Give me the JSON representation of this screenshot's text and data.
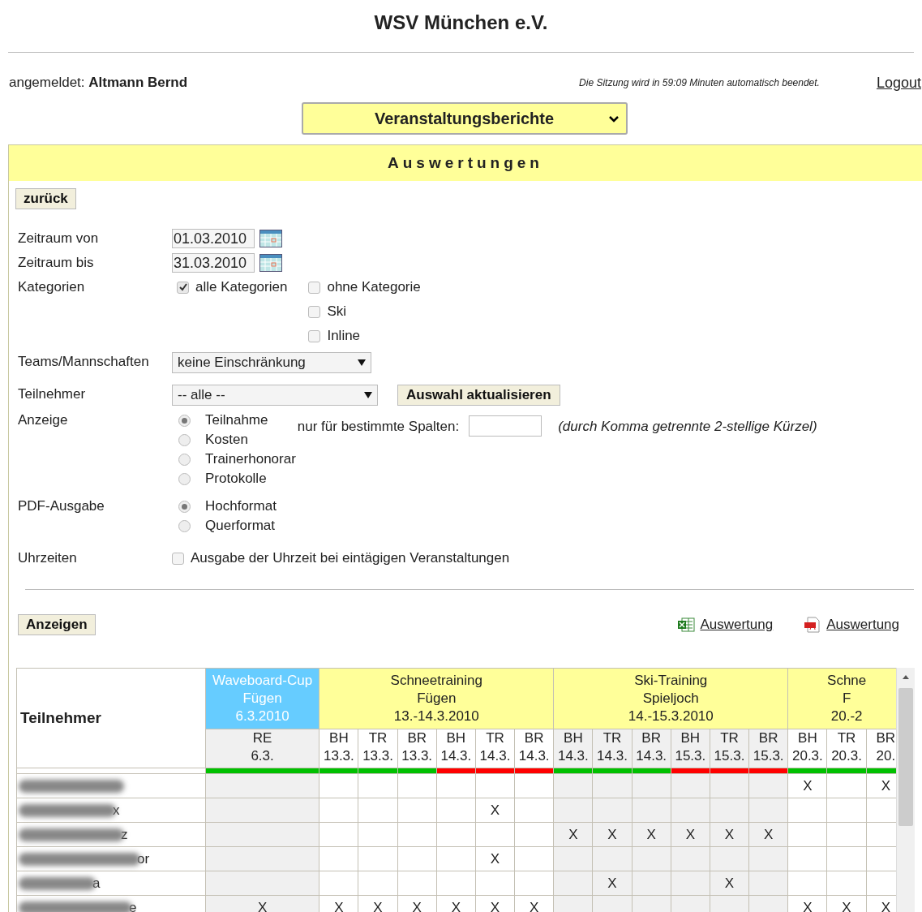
{
  "header": {
    "title": "WSV München e.V."
  },
  "user_bar": {
    "label": "angemeldet:",
    "user": "Altmann Bernd",
    "session_note": "Die Sitzung wird in 59:09 Minuten automatisch beendet.",
    "logout": "Logout"
  },
  "report_select": {
    "value": "Veranstaltungsberichte"
  },
  "panel": {
    "title": "Auswertungen",
    "back_button": "zurück",
    "form": {
      "period_from": {
        "label": "Zeitraum von",
        "value": "01.03.2010"
      },
      "period_to": {
        "label": "Zeitraum bis",
        "value": "31.03.2010"
      },
      "categories": {
        "label": "Kategorien",
        "options": [
          {
            "label": "alle Kategorien",
            "checked": true
          },
          {
            "label": "ohne Kategorie",
            "checked": false
          },
          {
            "label": "Ski",
            "checked": false
          },
          {
            "label": "Inline",
            "checked": false
          }
        ]
      },
      "teams": {
        "label": "Teams/Mannschaften",
        "value": "keine Einschränkung"
      },
      "participants": {
        "label": "Teilnehmer",
        "value": "-- alle --",
        "update_button": "Auswahl aktualisieren"
      },
      "display": {
        "label": "Anzeige",
        "options": [
          {
            "label": "Teilnahme",
            "selected": true
          },
          {
            "label": "Kosten",
            "selected": false
          },
          {
            "label": "Trainerhonorar",
            "selected": false
          },
          {
            "label": "Protokolle",
            "selected": false
          }
        ],
        "columns_label": "nur für bestimmte Spalten:",
        "columns_hint": "(durch Komma getrennte 2-stellige Kürzel)"
      },
      "pdf": {
        "label": "PDF-Ausgabe",
        "options": [
          {
            "label": "Hochformat",
            "selected": true
          },
          {
            "label": "Querformat",
            "selected": false
          }
        ]
      },
      "times": {
        "label": "Uhrzeiten",
        "option": {
          "label": "Ausgabe der Uhrzeit bei eintägigen Veranstaltungen",
          "checked": false
        }
      }
    },
    "show_button": "Anzeigen",
    "exports": [
      {
        "kind": "excel",
        "label": "Auswertung"
      },
      {
        "kind": "pdf",
        "label": "Auswertung"
      }
    ],
    "table": {
      "name_header": "Teilnehmer",
      "events": [
        {
          "lines": [
            "Waveboard-Cup",
            "Fügen",
            "6.3.2010"
          ],
          "kind": "highlight",
          "shaded": true,
          "columns": [
            {
              "code": "RE",
              "date": "6.3.",
              "color": "#00c000"
            }
          ]
        },
        {
          "lines": [
            "Schneetraining",
            "Fügen",
            "13.-14.3.2010"
          ],
          "kind": "normal",
          "shaded": false,
          "columns": [
            {
              "code": "BH",
              "date": "13.3.",
              "color": "#00c000"
            },
            {
              "code": "TR",
              "date": "13.3.",
              "color": "#00c000"
            },
            {
              "code": "BR",
              "date": "13.3.",
              "color": "#00c000"
            },
            {
              "code": "BH",
              "date": "14.3.",
              "color": "#ff0000"
            },
            {
              "code": "TR",
              "date": "14.3.",
              "color": "#ff0000"
            },
            {
              "code": "BR",
              "date": "14.3.",
              "color": "#ff0000"
            }
          ]
        },
        {
          "lines": [
            "Ski-Training",
            "Spieljoch",
            "14.-15.3.2010"
          ],
          "kind": "normal",
          "shaded": true,
          "columns": [
            {
              "code": "BH",
              "date": "14.3.",
              "color": "#00c000"
            },
            {
              "code": "TR",
              "date": "14.3.",
              "color": "#00c000"
            },
            {
              "code": "BR",
              "date": "14.3.",
              "color": "#00c000"
            },
            {
              "code": "BH",
              "date": "15.3.",
              "color": "#ff0000"
            },
            {
              "code": "TR",
              "date": "15.3.",
              "color": "#ff0000"
            },
            {
              "code": "BR",
              "date": "15.3.",
              "color": "#ff0000"
            }
          ]
        },
        {
          "lines": [
            "Schne",
            "F",
            "20.-2"
          ],
          "kind": "normal",
          "shaded": false,
          "columns": [
            {
              "code": "BH",
              "date": "20.3.",
              "color": "#00c000"
            },
            {
              "code": "TR",
              "date": "20.3.",
              "color": "#00c000"
            },
            {
              "code": "BR",
              "date": "20.",
              "color": "#00c000"
            }
          ]
        }
      ],
      "rows": [
        {
          "cells": [
            null,
            null,
            null,
            null,
            null,
            null,
            null,
            null,
            null,
            null,
            null,
            null,
            null,
            "X",
            null,
            "X"
          ]
        },
        {
          "name_tail": "x",
          "cells": [
            null,
            null,
            null,
            null,
            null,
            "X",
            null,
            null,
            null,
            null,
            null,
            null,
            null,
            null,
            null,
            null
          ]
        },
        {
          "name_tail": "z",
          "cells": [
            null,
            null,
            null,
            null,
            null,
            null,
            null,
            "X",
            "X",
            "X",
            "X",
            "X",
            "X",
            null,
            null,
            null
          ]
        },
        {
          "name_tail": "or",
          "cells": [
            null,
            null,
            null,
            null,
            null,
            "X",
            null,
            null,
            null,
            null,
            null,
            null,
            null,
            null,
            null,
            null
          ]
        },
        {
          "name_tail": "a",
          "cells": [
            null,
            null,
            null,
            null,
            null,
            null,
            null,
            null,
            "X",
            null,
            null,
            "X",
            null,
            null,
            null,
            null
          ]
        },
        {
          "name_tail": "e",
          "cells": [
            "X",
            "X",
            "X",
            "X",
            "X",
            "X",
            "X",
            null,
            null,
            null,
            null,
            null,
            null,
            "X",
            "X",
            "X"
          ]
        }
      ]
    }
  }
}
